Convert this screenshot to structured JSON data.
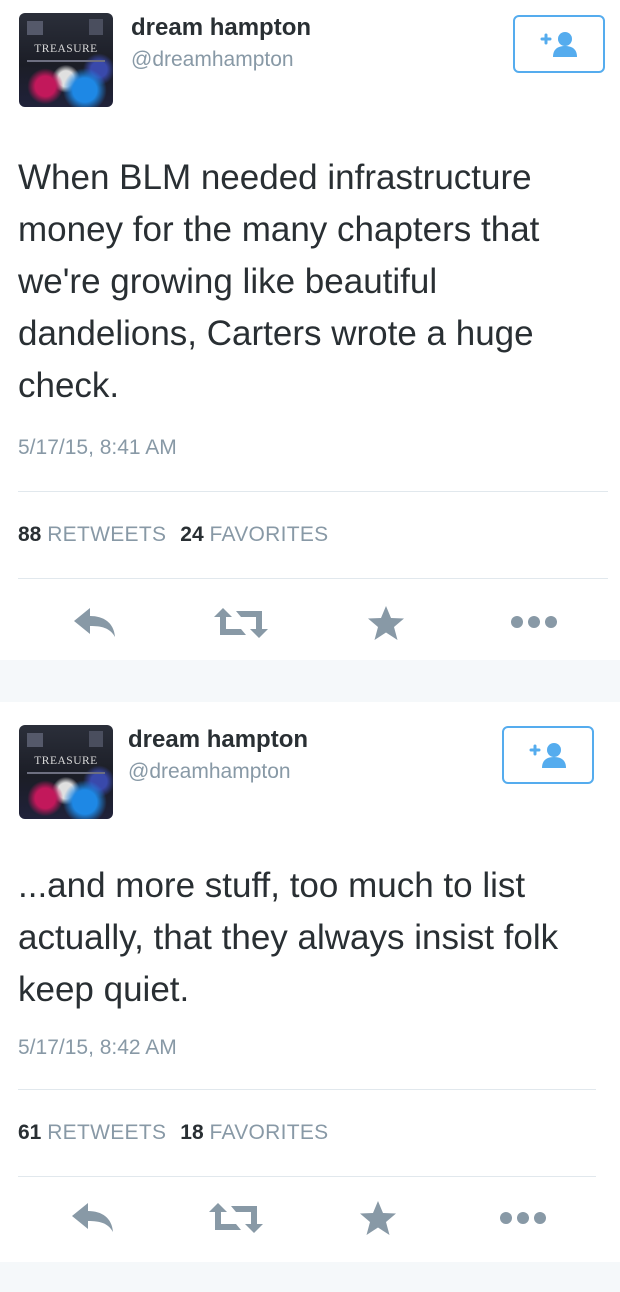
{
  "colors": {
    "accent": "#55acee",
    "action_icon": "#8899a6",
    "text": "#292f33",
    "muted": "#8899a6"
  },
  "tweets": [
    {
      "name": "dream hampton",
      "handle": "@dreamhampton",
      "avatar_text": "TREASURE",
      "text": "When BLM needed infrastructure money for the many chapters that we're growing like beautiful dandelions, Carters wrote a huge check.",
      "timestamp": "5/17/15, 8:41 AM",
      "retweets_count": "88",
      "retweets_label": "RETWEETS",
      "favorites_count": "24",
      "favorites_label": "FAVORITES",
      "follow_icon": "add-user-icon",
      "actions": [
        "reply-icon",
        "retweet-icon",
        "favorite-star-icon",
        "more-dots-icon"
      ]
    },
    {
      "name": "dream hampton",
      "handle": "@dreamhampton",
      "avatar_text": "TREASURE",
      "text": "...and more stuff, too much to list actually, that they always insist folk keep quiet.",
      "timestamp": "5/17/15, 8:42 AM",
      "retweets_count": "61",
      "retweets_label": "RETWEETS",
      "favorites_count": "18",
      "favorites_label": "FAVORITES",
      "follow_icon": "add-user-icon",
      "actions": [
        "reply-icon",
        "retweet-icon",
        "favorite-star-icon",
        "more-dots-icon"
      ]
    }
  ]
}
